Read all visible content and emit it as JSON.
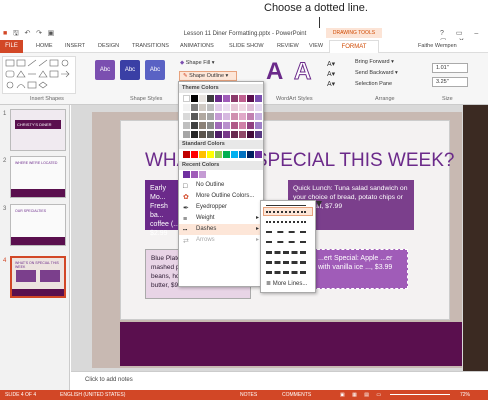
{
  "callout": "Choose a dotted line.",
  "window": {
    "title": "Lesson 11 Diner Formatting.pptx - PowerPoint",
    "context_tab": "DRAWING TOOLS",
    "user": "Faithe Wempen",
    "controls": "? ▭ – ▢ ✕"
  },
  "tabs": [
    "FILE",
    "HOME",
    "INSERT",
    "DESIGN",
    "TRANSITIONS",
    "ANIMATIONS",
    "SLIDE SHOW",
    "REVIEW",
    "VIEW",
    "FORMAT"
  ],
  "ribbon": {
    "groups": [
      "Insert Shapes",
      "Shape Styles",
      "WordArt Styles",
      "Arrange",
      "Size"
    ],
    "style_button": "Abc",
    "shape_fill": "Shape Fill ▾",
    "shape_outline": "Shape Outline ▾",
    "wordart": "A",
    "arrange": [
      "Bring Forward ▾",
      "Send Backward ▾",
      "Selection Pane"
    ],
    "size": [
      "1.01\"",
      "3.25\""
    ]
  },
  "dropdown": {
    "theme_colors": "Theme Colors",
    "standard_colors": "Standard Colors",
    "recent_colors": "Recent Colors",
    "items": [
      "No Outline",
      "More Outline Colors...",
      "Eyedropper",
      "Weight",
      "Dashes",
      "Arrows"
    ]
  },
  "submenu": {
    "more_lines": "More Lines..."
  },
  "slide": {
    "title": "WHAT'S ON SPECIAL THIS WEEK?",
    "boxes": {
      "early": "Early Mo... Fresh ba... coffee (... $2.99",
      "lunch": "Quick Lunch: Tuna salad sandwich on your choice of bread, potato chips or fresh fruit, $7.99",
      "blue_plate": "Blue Plate Special: Meatloaf, mashed potatoes, gravy, green beans, homemade rolls with butter, $9.99",
      "dessert": "...ert Special: Apple ...er with vanilla ice ..., $3.99"
    }
  },
  "thumbnails": [
    {
      "num": "1",
      "text": "CHRISTY'S DINER"
    },
    {
      "num": "2",
      "text": "WHERE WE'RE LOCATED"
    },
    {
      "num": "3",
      "text": "OUR SPECIALTIES"
    },
    {
      "num": "4",
      "text": "WHAT'S ON SPECIAL THIS WEEK"
    }
  ],
  "notes": "Click to add notes",
  "status": {
    "slide": "SLIDE 4 OF 4",
    "lang": "ENGLISH (UNITED STATES)",
    "notes": "NOTES",
    "comments": "COMMENTS",
    "zoom": "72%"
  },
  "colors": {
    "accent": "#d24726",
    "purple": "#6b2a8a"
  }
}
